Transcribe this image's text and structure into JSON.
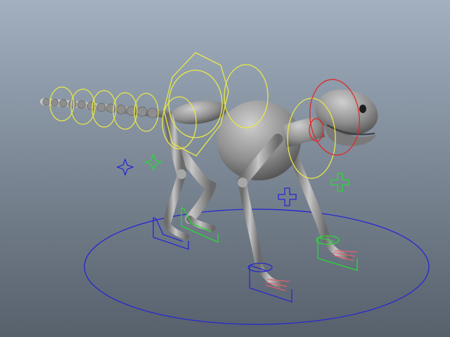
{
  "viewport": {
    "background_top": "#a2b0c0",
    "background_bottom": "#57606b"
  },
  "scene": {
    "model": "quadruped-character",
    "model_color": "#9a9a9a",
    "control_colors": {
      "spine_and_tail": "#e8e84a",
      "head_and_neck": "#e02828",
      "left_side": "#28d838",
      "right_side": "#2828d0",
      "ground": "#2828d0",
      "toes": "#e06070"
    },
    "icons": [
      "ground-circle-control",
      "foot-ik-control",
      "pole-vector-control"
    ]
  }
}
